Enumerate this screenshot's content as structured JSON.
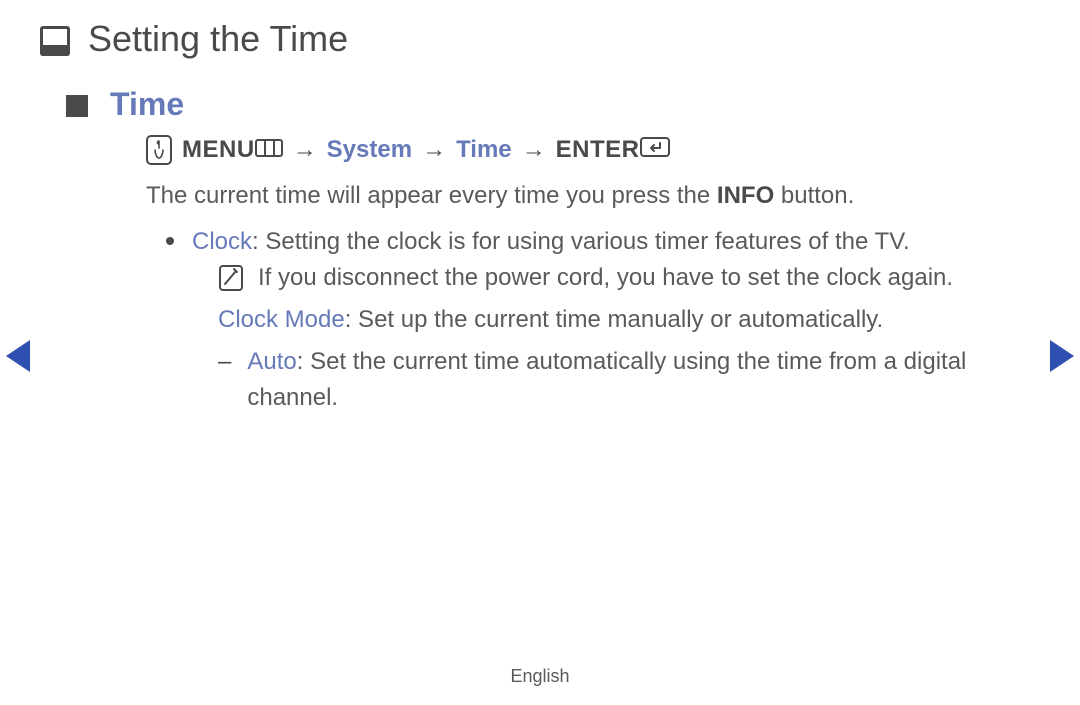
{
  "title": "Setting the Time",
  "section": "Time",
  "path": {
    "menu": "MENU",
    "arrow": "→",
    "system": "System",
    "time": "Time",
    "enter": "ENTER"
  },
  "intro": {
    "prefix": "The current time will appear every time you press the ",
    "bold": "INFO",
    "suffix": " button."
  },
  "clock": {
    "term": "Clock",
    "text": ": Setting the clock is for using various timer features of the TV."
  },
  "note": "If you disconnect the power cord, you have to set the clock again.",
  "clockMode": {
    "term": "Clock Mode",
    "text": ": Set up the current time manually or automatically."
  },
  "auto": {
    "dash": "–",
    "term": "Auto",
    "text": ": Set the current time automatically using the time from a digital channel."
  },
  "footer": "English"
}
